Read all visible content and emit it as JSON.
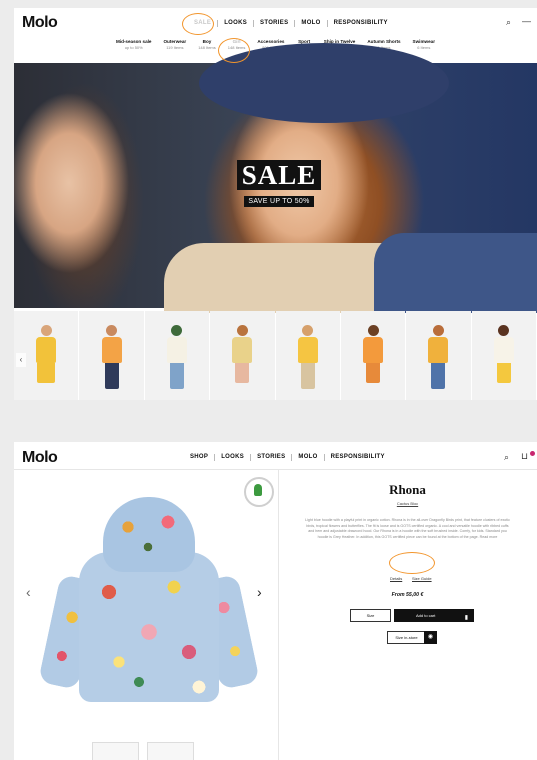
{
  "shot1": {
    "logo": "Molo",
    "nav": [
      "SALE",
      "LOOKS",
      "STORIES",
      "MOLO",
      "RESPONSIBILITY"
    ],
    "subnav": [
      {
        "title": "Mid-season sale",
        "sub": "up to 50%"
      },
      {
        "title": "Outerwear",
        "sub": "119 Items"
      },
      {
        "title": "Boy",
        "sub": "148 Items"
      },
      {
        "title": "Girl",
        "sub": "148 Items"
      },
      {
        "title": "Accessories",
        "sub": "806 Items"
      },
      {
        "title": "Sport",
        "sub": "21 Items"
      },
      {
        "title": "Ship in Twelve",
        "sub": "39 Items"
      },
      {
        "title": "Autumn Shorts",
        "sub": "6 Items"
      },
      {
        "title": "Swimwear",
        "sub": "6 Items"
      }
    ],
    "hero": {
      "headline": "SALE",
      "subline": "SAVE UP TO 50%"
    },
    "icons": {
      "search": "⌕",
      "cart": "—",
      "arrow_left": "‹"
    }
  },
  "shot2": {
    "logo": "Molo",
    "nav": [
      "SHOP",
      "LOOKS",
      "STORIES",
      "MOLO",
      "RESPONSIBILITY"
    ],
    "product": {
      "name": "Rhona",
      "subtitle": "Cactus Bloc",
      "description": "Light blue hoodie with a playful print in organic cotton. Rhona is in the all-over Dragonfly Birds print, that feature clusters of exotic birds, tropical flowers and butterflies. The fit is loose and is GOTS certified organic. A cool and versatile hoodie with ribbed cuffs and hem and adjustable drawcord hood. Our Rhona is in a hoodie with the soft brushed inside. Comfy, for kids. Standard you hoodie is Grey Heather. In addition, this GOTS certified piece can be found at the bottom of the page. Read more",
      "link_left": "Details",
      "link_right": "Size Guide",
      "price": "From 55,00 €",
      "size_placeholder": "Size",
      "add_label": "Add to cart",
      "size_guide": "Size in-store"
    },
    "icons": {
      "search": "⌕",
      "cart": "⊔",
      "prev": "‹",
      "next": "›",
      "bag": "🛍",
      "pin": "◉"
    }
  }
}
